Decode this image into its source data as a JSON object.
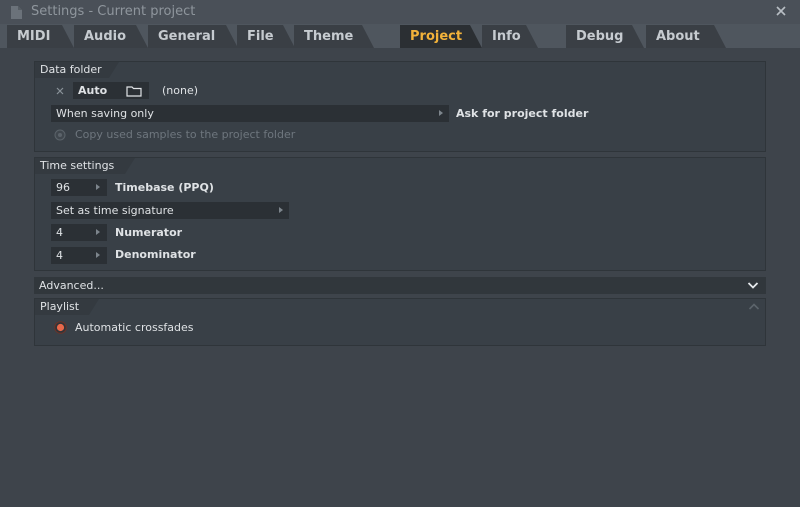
{
  "window": {
    "title": "Settings - Current project"
  },
  "tabs": [
    {
      "label": "MIDI"
    },
    {
      "label": "Audio"
    },
    {
      "label": "General"
    },
    {
      "label": "File"
    },
    {
      "label": "Theme"
    },
    {
      "label": "Project",
      "active": true
    },
    {
      "label": "Info"
    },
    {
      "label": "Debug"
    },
    {
      "label": "About"
    }
  ],
  "data_folder": {
    "header": "Data folder",
    "auto_label": "Auto",
    "folder_value": "(none)",
    "when_saving": "When saving only",
    "ask_label": "Ask for project folder",
    "copy_samples_label": "Copy used samples to the project folder"
  },
  "time_settings": {
    "header": "Time settings",
    "timebase_value": "96",
    "timebase_label": "Timebase (PPQ)",
    "time_sig_mode": "Set as time signature",
    "numerator_value": "4",
    "numerator_label": "Numerator",
    "denominator_value": "4",
    "denominator_label": "Denominator"
  },
  "advanced": {
    "label": "Advanced..."
  },
  "playlist": {
    "header": "Playlist",
    "crossfades_label": "Automatic crossfades"
  },
  "colors": {
    "active_tab": "#f2b23a",
    "radio_on": "#e8684a"
  }
}
